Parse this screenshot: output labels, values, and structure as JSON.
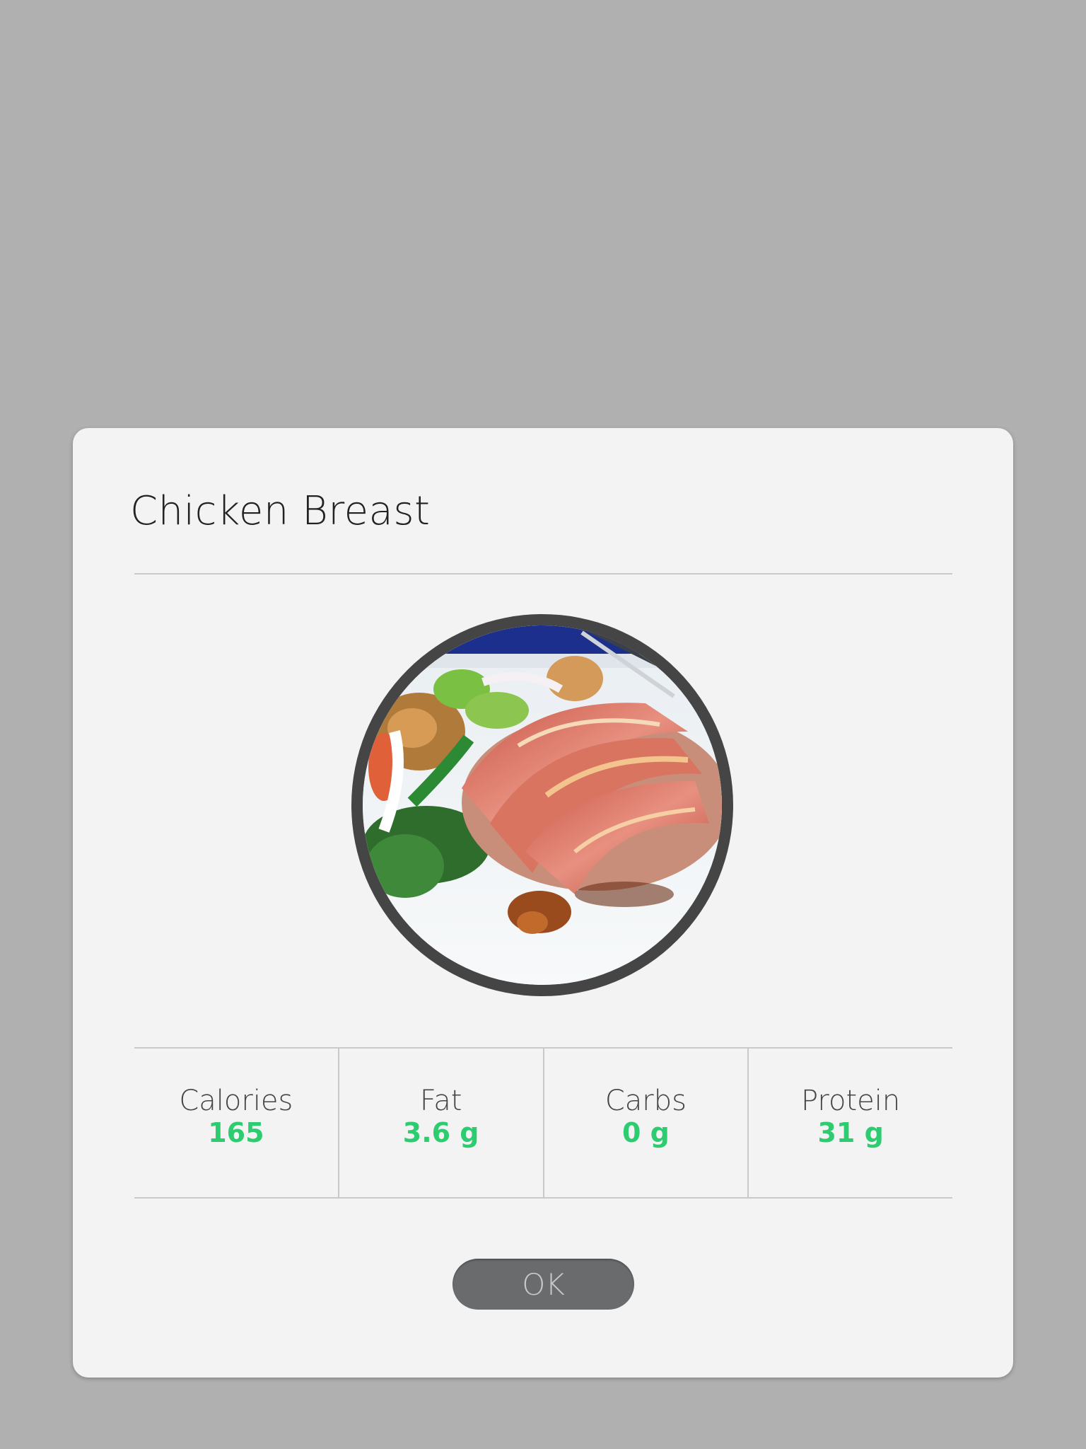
{
  "dialog": {
    "title": "Chicken Breast",
    "image": {
      "subject": "bacon-wrapped chicken breast with salad"
    },
    "nutrition": [
      {
        "label": "Calories",
        "value": "165"
      },
      {
        "label": "Fat",
        "value": "3.6 g"
      },
      {
        "label": "Carbs",
        "value": "0 g"
      },
      {
        "label": "Protein",
        "value": "31 g"
      }
    ],
    "ok_label": "OK"
  },
  "colors": {
    "backdrop": "#b0b0b0",
    "dialog_bg": "#f2f3f2",
    "accent_value": "#2ecc71",
    "button_bg": "#6a6b6d"
  }
}
